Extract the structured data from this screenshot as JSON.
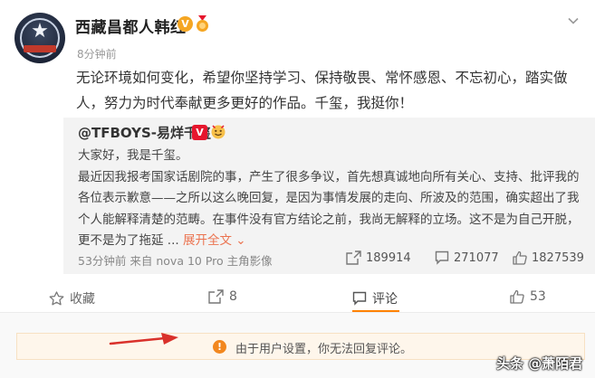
{
  "post": {
    "author": "西藏昌都人韩红",
    "verified_badge": "V",
    "time": "8分钟前",
    "text_line1": "无论环境如何变化，希望你坚持学习、保持敬畏、常怀感恩、不忘初心，踏实做",
    "text_line2": "人，努力为时代奉献更多更好的作品。千玺，我挺你！"
  },
  "repost": {
    "author": "@TFBOYS-易烊千玺",
    "verified_badge": "V",
    "lines": [
      "大家好，我是千玺。",
      "最近因我报考国家话剧院的事，产生了很多争议，首先想真诚地向所有关心、支持、批评我的",
      "各位表示歉意——之所以这么晚回复，是因为事情发展的走向、所波及的范围，确实超出了我",
      "个人能解释清楚的范畴。在事件没有官方结论之前，我尚无解释的立场。这不是为自己开脱，"
    ],
    "last_line": "更不是为了拖延 ...",
    "expand_label": "展开全文",
    "meta": "53分钟前 来自 nova 10 Pro 主角影像",
    "reposts": "189914",
    "comments": "271077",
    "likes": "1827539"
  },
  "actions": {
    "favorite": "收藏",
    "repost": "8",
    "comment": "评论",
    "like": "53"
  },
  "notice": {
    "text": "由于用户设置，你无法回复评论。"
  },
  "watermark": "头条 @萧陌君",
  "colors": {
    "accent": "#ff8200",
    "link": "#eb7350",
    "notice_bg": "#fef6eb",
    "notice_icon": "#f2871e",
    "arrow": "#d9312b"
  }
}
